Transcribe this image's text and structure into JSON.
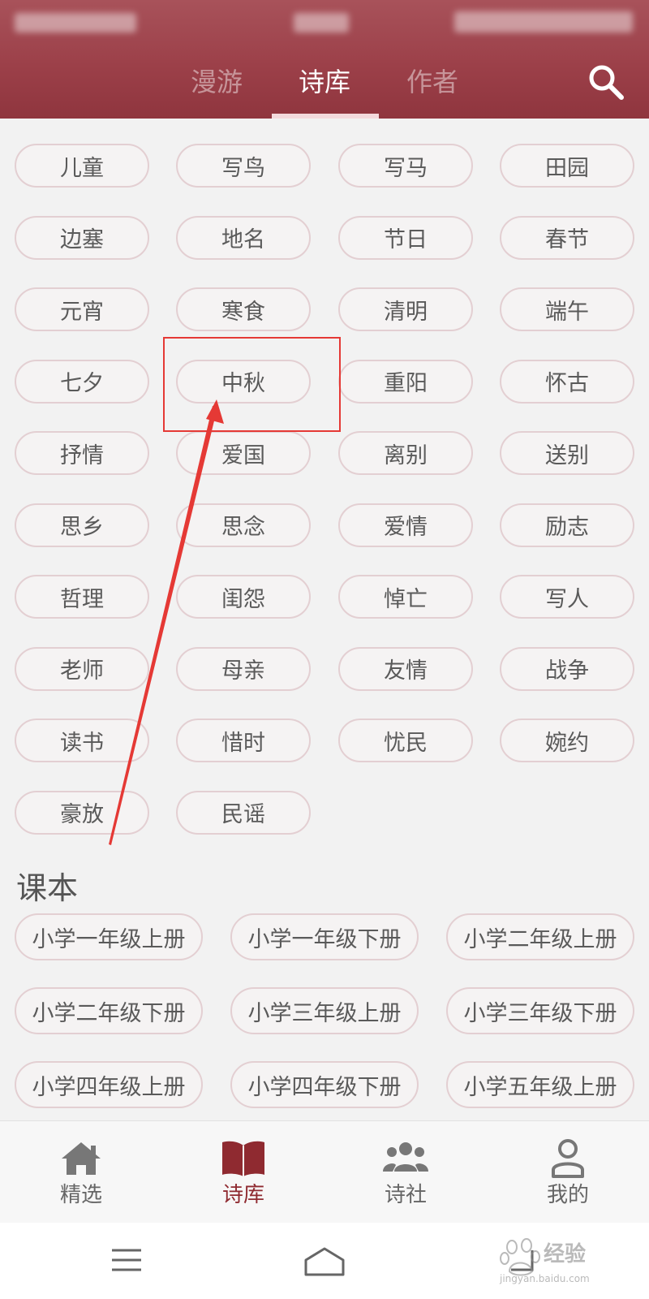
{
  "header": {
    "tabs": [
      {
        "label": "漫游"
      },
      {
        "label": "诗库"
      },
      {
        "label": "作者"
      }
    ],
    "active_tab": "诗库",
    "search_icon": "search-icon"
  },
  "tags": [
    "儿童",
    "写鸟",
    "写马",
    "田园",
    "边塞",
    "地名",
    "节日",
    "春节",
    "元宵",
    "寒食",
    "清明",
    "端午",
    "七夕",
    "中秋",
    "重阳",
    "怀古",
    "抒情",
    "爱国",
    "离别",
    "送别",
    "思乡",
    "思念",
    "爱情",
    "励志",
    "哲理",
    "闺怨",
    "悼亡",
    "写人",
    "老师",
    "母亲",
    "友情",
    "战争",
    "读书",
    "惜时",
    "忧民",
    "婉约",
    "豪放",
    "民谣"
  ],
  "highlighted_tag": "中秋",
  "textbook": {
    "title": "课本",
    "items": [
      "小学一年级上册",
      "小学一年级下册",
      "小学二年级上册",
      "小学二年级下册",
      "小学三年级上册",
      "小学三年级下册",
      "小学四年级上册",
      "小学四年级下册",
      "小学五年级上册"
    ]
  },
  "bottom_nav": [
    {
      "label": "精选",
      "icon": "home-icon"
    },
    {
      "label": "诗库",
      "icon": "book-icon"
    },
    {
      "label": "诗社",
      "icon": "group-icon"
    },
    {
      "label": "我的",
      "icon": "user-icon"
    }
  ],
  "active_nav": "诗库",
  "watermark": {
    "text": "经验",
    "brand": "Bai du",
    "url": "jingyan.baidu.com"
  },
  "colors": {
    "header": "#9c4049",
    "accent": "#8f2a30",
    "pill_border": "#e3cfd2",
    "annotation": "#e53935"
  }
}
